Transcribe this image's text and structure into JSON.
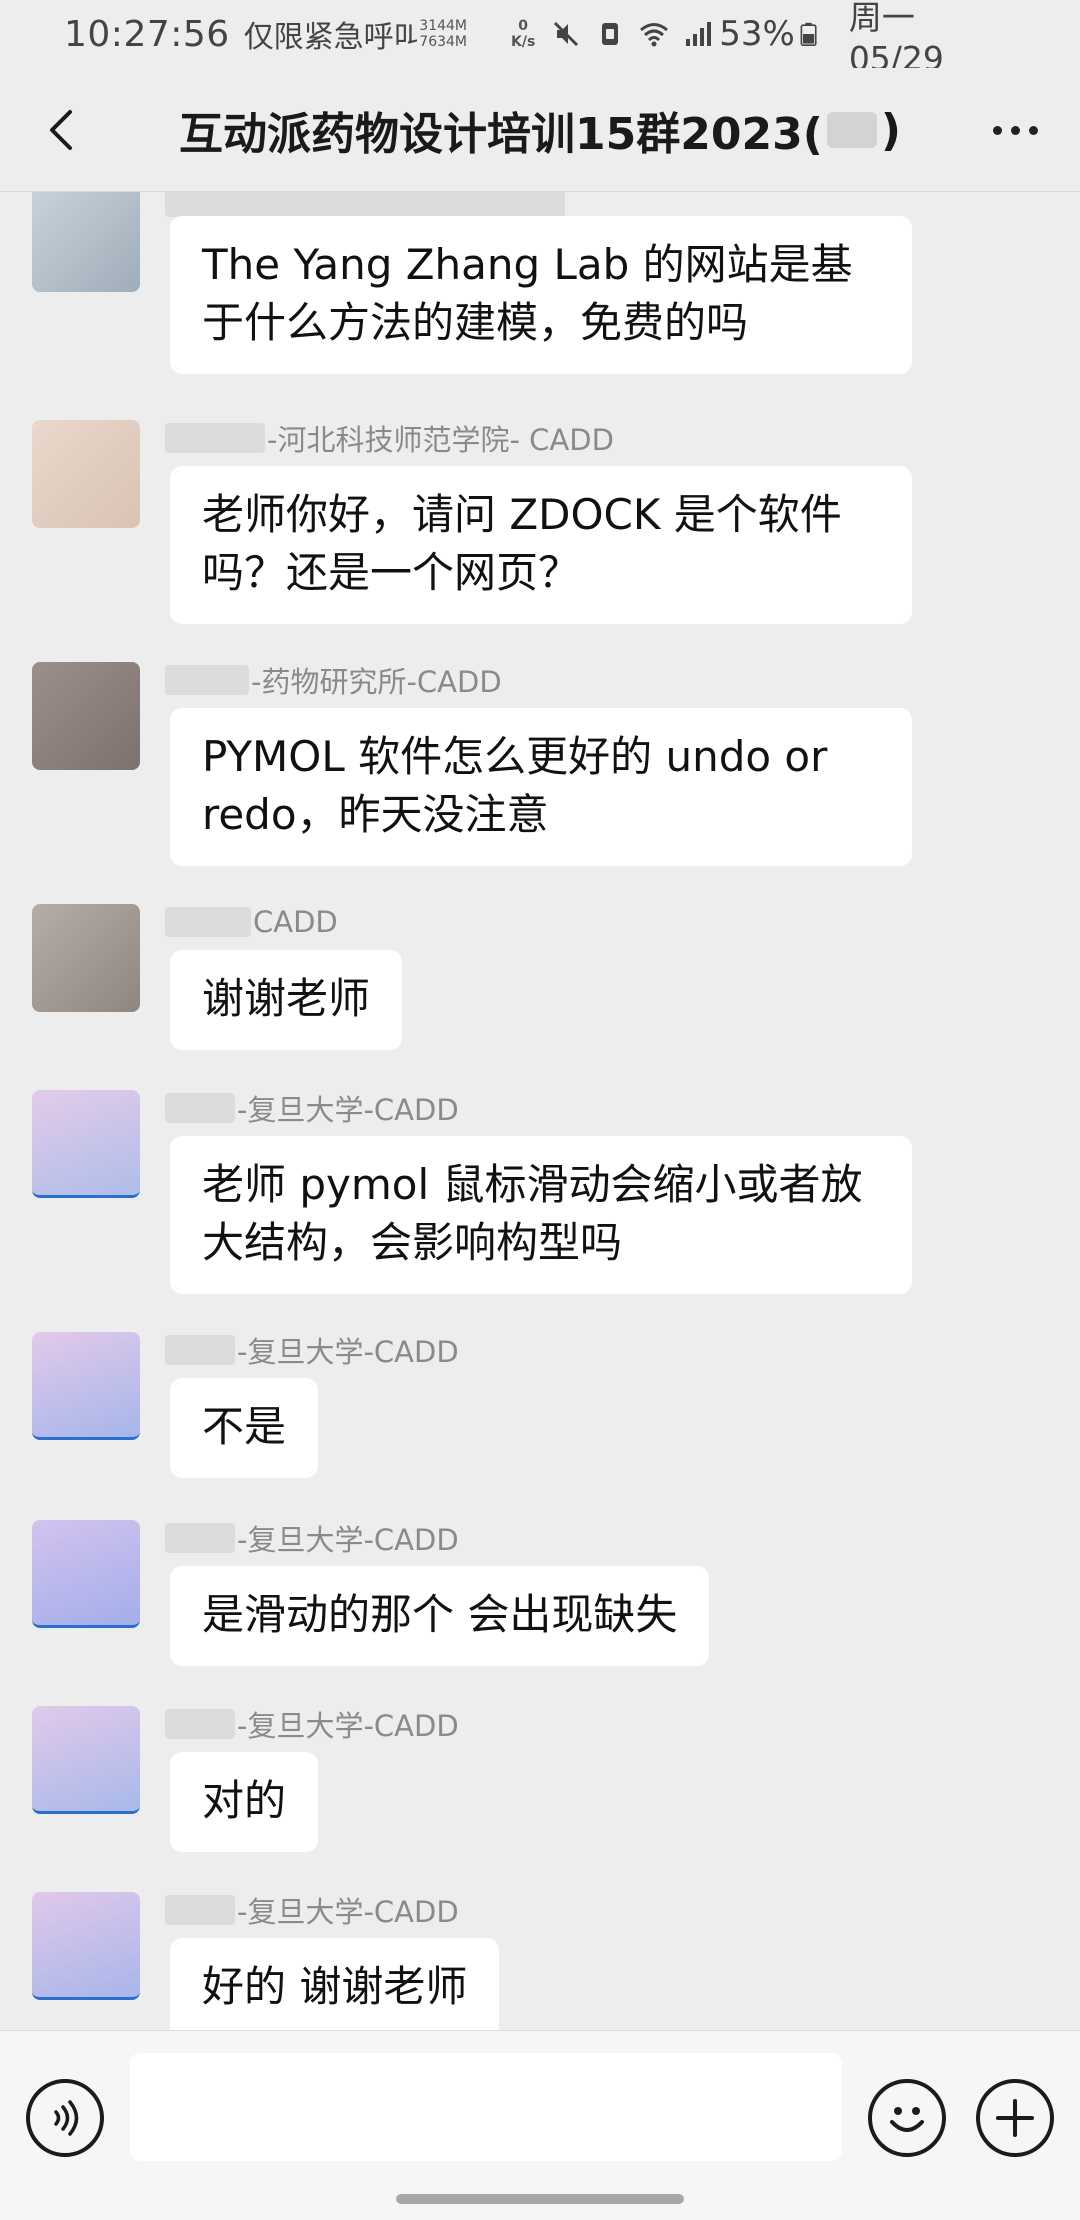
{
  "status_bar": {
    "time": "10:27:56",
    "emergency_text": "仅限紧急呼叫",
    "mem_top": "3144M",
    "mem_bottom": "7634M",
    "net_speed_value": "0",
    "net_speed_unit": "K/s",
    "battery_pct": "53%",
    "date": "周一 05/29",
    "icons": [
      "mute-icon",
      "nfc-icon",
      "wifi-icon",
      "signal-icon",
      "battery-icon"
    ]
  },
  "header": {
    "title_prefix": "互动派药物设计培训15群2023(",
    "title_suffix": ")"
  },
  "messages": [
    {
      "sender": "",
      "text": "The Yang Zhang Lab 的网站是基于什么方法的建模，免费的吗",
      "avatar_color": "#b9c4cd"
    },
    {
      "sender": "-河北科技师范学院- CADD",
      "text": "老师你好，请问 ZDOCK 是个软件吗？还是一个网页？",
      "avatar_color": "#e3cfc2"
    },
    {
      "sender": "-药物研究所-CADD",
      "text": "PYMOL 软件怎么更好的 undo or redo，昨天没注意",
      "avatar_color": "#8f8380"
    },
    {
      "sender": "CADD",
      "text": "谢谢老师",
      "avatar_color": "#a49d94"
    },
    {
      "sender": "-复旦大学-CADD",
      "text": "老师 pymol 鼠标滑动会缩小或者放大结构，会影响构型吗",
      "avatar_color": "#c9c3e6"
    },
    {
      "sender": "-复旦大学-CADD",
      "text": "不是",
      "avatar_color": "#c2c2ea"
    },
    {
      "sender": "-复旦大学-CADD",
      "text": "是滑动的那个 会出现缺失",
      "avatar_color": "#bcbde8"
    },
    {
      "sender": "-复旦大学-CADD",
      "text": "对的",
      "avatar_color": "#c8c2e6"
    },
    {
      "sender": "-复旦大学-CADD",
      "text": "好的 谢谢老师",
      "avatar_color": "#c4c1e8"
    }
  ],
  "input_bar": {
    "placeholder": ""
  },
  "colors": {
    "background": "#ededed",
    "bubble": "#ffffff",
    "sender_text": "#8a8a8a"
  }
}
